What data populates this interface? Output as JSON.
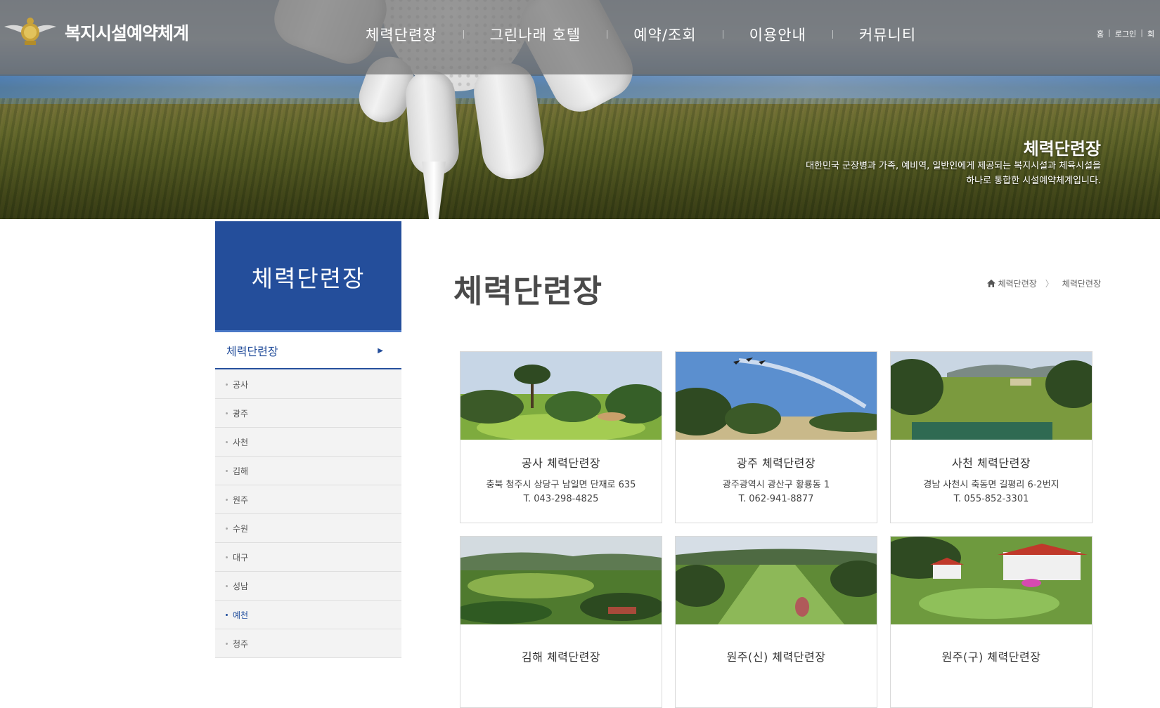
{
  "header": {
    "brand": "복지시설예약체계",
    "nav": [
      "체력단련장",
      "그린나래 호텔",
      "예약/조회",
      "이용안내",
      "커뮤니티"
    ],
    "util": [
      "홈",
      "로그인",
      "회"
    ]
  },
  "hero": {
    "title": "체력단련장",
    "desc_line1": "대한민국 군장병과 가족, 예비역, 일반인에게 제공되는 복지시설과 체육시설을",
    "desc_line2": "하나로 통합한 시설예약체계입니다."
  },
  "sidebar": {
    "title": "체력단련장",
    "active": "체력단련장",
    "items": [
      "공사",
      "광주",
      "사천",
      "김해",
      "원주",
      "수원",
      "대구",
      "성남",
      "예천",
      "청주"
    ],
    "selected_item": "예천"
  },
  "main": {
    "title": "체력단련장",
    "breadcrumb": [
      "체력단련장",
      "체력단련장"
    ],
    "cards": [
      {
        "name": "공사 체력단련장",
        "addr": "충북 청주시 상당구 남일면 단재로 635",
        "tel": "T. 043-298-4825"
      },
      {
        "name": "광주 체력단련장",
        "addr": "광주광역시 광산구 황룡동 1",
        "tel": "T. 062-941-8877"
      },
      {
        "name": "사천 체력단련장",
        "addr": "경남 사천시 축동면 길평리 6-2번지",
        "tel": "T. 055-852-3301"
      },
      {
        "name": "김해 체력단련장"
      },
      {
        "name": "원주(신) 체력단련장"
      },
      {
        "name": "원주(구) 체력단련장"
      }
    ]
  },
  "colors": {
    "primary": "#244e9b",
    "sidebar_bg": "#f3f3f3"
  }
}
